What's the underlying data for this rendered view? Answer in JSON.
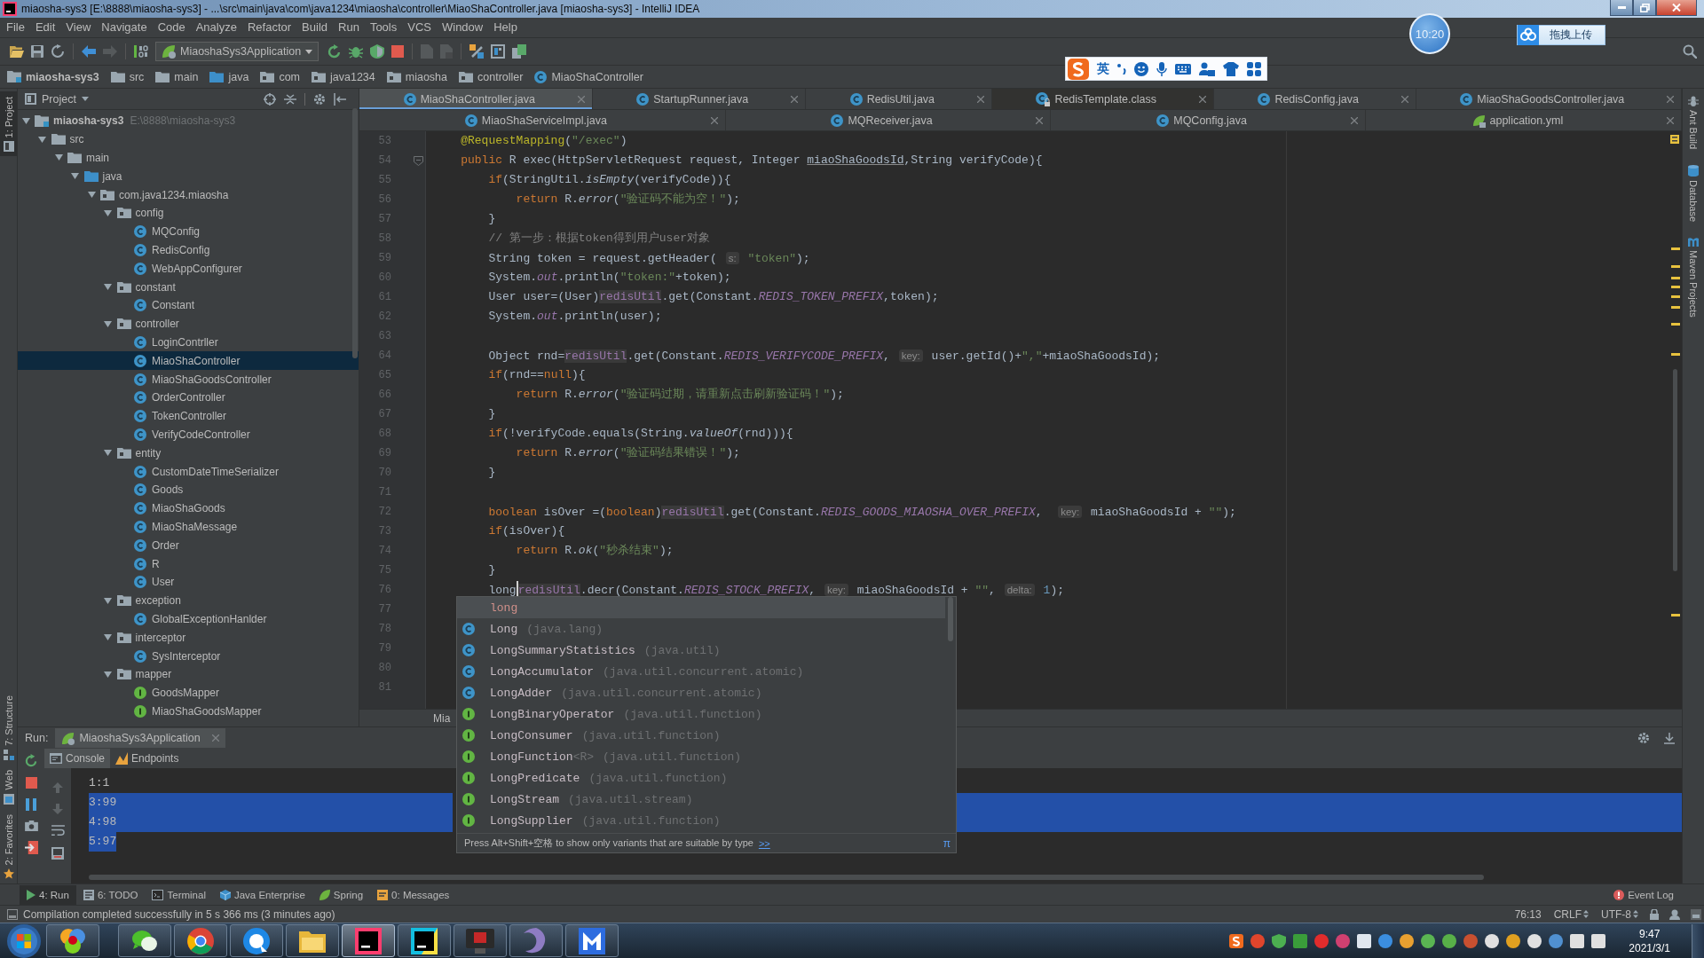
{
  "window": {
    "title": "miaosha-sys3 [E:\\8888\\miaosha-sys3] - ...\\src\\main\\java\\com\\java1234\\miaosha\\controller\\MiaoShaController.java [miaosha-sys3] - IntelliJ IDEA"
  },
  "menu": [
    "File",
    "Edit",
    "View",
    "Navigate",
    "Code",
    "Analyze",
    "Refactor",
    "Build",
    "Run",
    "Tools",
    "VCS",
    "Window",
    "Help"
  ],
  "toolbar": {
    "run_configuration": "MiaoshaSys3Application"
  },
  "overlays": {
    "recorder_time": "10:20",
    "upload_button": "拖拽上传",
    "ime_mode": "英"
  },
  "navigation_bar": [
    {
      "label": "miaosha-sys3",
      "kind": "module"
    },
    {
      "label": "src",
      "kind": "folder"
    },
    {
      "label": "main",
      "kind": "folder"
    },
    {
      "label": "java",
      "kind": "source-folder"
    },
    {
      "label": "com",
      "kind": "package"
    },
    {
      "label": "java1234",
      "kind": "package"
    },
    {
      "label": "miaosha",
      "kind": "package"
    },
    {
      "label": "controller",
      "kind": "package"
    },
    {
      "label": "MiaoShaController",
      "kind": "class"
    }
  ],
  "tool_stripe_left": [
    {
      "label": "1: Project",
      "selected": true
    },
    {
      "label": "7: Structure",
      "selected": false
    },
    {
      "label": "Web",
      "selected": false
    },
    {
      "label": "2: Favorites",
      "selected": false
    }
  ],
  "tool_stripe_right": [
    {
      "label": "Ant Build"
    },
    {
      "label": "Database"
    },
    {
      "label": "Maven Projects"
    }
  ],
  "project_panel": {
    "title": "Project",
    "tree": [
      {
        "label": "miaosha-sys3",
        "path": "E:\\8888\\miaosha-sys3",
        "kind": "module",
        "expanded": true,
        "selected": false,
        "children": [
          {
            "label": "src",
            "kind": "folder",
            "expanded": true,
            "selected": false,
            "children": [
              {
                "label": "main",
                "kind": "folder",
                "expanded": true,
                "selected": false,
                "children": [
                  {
                    "label": "java",
                    "kind": "source-folder",
                    "expanded": true,
                    "selected": false,
                    "children": [
                      {
                        "label": "com.java1234.miaosha",
                        "kind": "package",
                        "expanded": true,
                        "selected": false,
                        "children": [
                          {
                            "label": "config",
                            "kind": "package",
                            "expanded": true,
                            "selected": false,
                            "children": [
                              {
                                "label": "MQConfig",
                                "kind": "class",
                                "selected": false
                              },
                              {
                                "label": "RedisConfig",
                                "kind": "class",
                                "selected": false
                              },
                              {
                                "label": "WebAppConfigurer",
                                "kind": "class",
                                "selected": false
                              }
                            ]
                          },
                          {
                            "label": "constant",
                            "kind": "package",
                            "expanded": true,
                            "selected": false,
                            "children": [
                              {
                                "label": "Constant",
                                "kind": "class",
                                "selected": false
                              }
                            ]
                          },
                          {
                            "label": "controller",
                            "kind": "package",
                            "expanded": true,
                            "selected": false,
                            "children": [
                              {
                                "label": "LoginContrller",
                                "kind": "class",
                                "selected": false
                              },
                              {
                                "label": "MiaoShaController",
                                "kind": "class",
                                "selected": true
                              },
                              {
                                "label": "MiaoShaGoodsController",
                                "kind": "class",
                                "selected": false
                              },
                              {
                                "label": "OrderController",
                                "kind": "class",
                                "selected": false
                              },
                              {
                                "label": "TokenController",
                                "kind": "class",
                                "selected": false
                              },
                              {
                                "label": "VerifyCodeController",
                                "kind": "class",
                                "selected": false
                              }
                            ]
                          },
                          {
                            "label": "entity",
                            "kind": "package",
                            "expanded": true,
                            "selected": false,
                            "children": [
                              {
                                "label": "CustomDateTimeSerializer",
                                "kind": "class",
                                "selected": false
                              },
                              {
                                "label": "Goods",
                                "kind": "class",
                                "selected": false
                              },
                              {
                                "label": "MiaoShaGoods",
                                "kind": "class",
                                "selected": false
                              },
                              {
                                "label": "MiaoShaMessage",
                                "kind": "class",
                                "selected": false
                              },
                              {
                                "label": "Order",
                                "kind": "class",
                                "selected": false
                              },
                              {
                                "label": "R",
                                "kind": "class",
                                "selected": false
                              },
                              {
                                "label": "User",
                                "kind": "class",
                                "selected": false
                              }
                            ]
                          },
                          {
                            "label": "exception",
                            "kind": "package",
                            "expanded": true,
                            "selected": false,
                            "children": [
                              {
                                "label": "GlobalExceptionHanlder",
                                "kind": "class",
                                "selected": false
                              }
                            ]
                          },
                          {
                            "label": "interceptor",
                            "kind": "package",
                            "expanded": true,
                            "selected": false,
                            "children": [
                              {
                                "label": "SysInterceptor",
                                "kind": "class",
                                "selected": false
                              }
                            ]
                          },
                          {
                            "label": "mapper",
                            "kind": "package",
                            "expanded": true,
                            "selected": false,
                            "children": [
                              {
                                "label": "GoodsMapper",
                                "kind": "interface",
                                "selected": false
                              },
                              {
                                "label": "MiaoShaGoodsMapper",
                                "kind": "interface",
                                "selected": false
                              }
                            ]
                          }
                        ]
                      }
                    ]
                  }
                ]
              }
            ]
          }
        ]
      }
    ]
  },
  "editor_tabs": {
    "rows": [
      {
        "tabs": [
          {
            "label": "MiaoShaController.java",
            "kind": "class",
            "selected": true
          },
          {
            "label": "StartupRunner.java",
            "kind": "class",
            "selected": false
          },
          {
            "label": "RedisUtil.java",
            "kind": "class",
            "selected": false
          },
          {
            "label": "RedisTemplate.class",
            "kind": "library-class",
            "selected": false
          },
          {
            "label": "RedisConfig.java",
            "kind": "class",
            "selected": false
          },
          {
            "label": "MiaoShaGoodsController.java",
            "kind": "class",
            "selected": false
          }
        ]
      },
      {
        "tabs": [
          {
            "label": "MiaoShaServiceImpl.java",
            "kind": "class",
            "selected": false
          },
          {
            "label": "MQReceiver.java",
            "kind": "class",
            "selected": false
          },
          {
            "label": "MQConfig.java",
            "kind": "class",
            "selected": false
          },
          {
            "label": "application.yml",
            "kind": "config",
            "selected": false
          }
        ]
      }
    ]
  },
  "editor": {
    "lines": [
      {
        "number": "53",
        "tokens": [
          {
            "kind": "annotation",
            "text": "    @RequestMapping"
          },
          {
            "kind": "plain",
            "text": "("
          },
          {
            "kind": "string",
            "text": "\"/exec\""
          },
          {
            "kind": "plain",
            "text": ")"
          }
        ]
      },
      {
        "number": "54",
        "fold_marker": true,
        "tokens": [
          {
            "kind": "keyword",
            "text": "    public"
          },
          {
            "kind": "plain",
            "text": " R exec(HttpServletRequest request, Integer "
          },
          {
            "kind": "underlined",
            "text": "miaoShaGoodsId"
          },
          {
            "kind": "plain",
            "text": ",String verifyCode){"
          }
        ]
      },
      {
        "number": "55",
        "tokens": [
          {
            "kind": "keyword",
            "text": "        if"
          },
          {
            "kind": "plain",
            "text": "(StringUtil."
          },
          {
            "kind": "static-method",
            "text": "isEmpty"
          },
          {
            "kind": "plain",
            "text": "(verifyCode)){"
          }
        ]
      },
      {
        "number": "56",
        "tokens": [
          {
            "kind": "keyword",
            "text": "            return"
          },
          {
            "kind": "plain",
            "text": " R."
          },
          {
            "kind": "static-method",
            "text": "error"
          },
          {
            "kind": "plain",
            "text": "("
          },
          {
            "kind": "string",
            "text": "\"验证码不能为空！\""
          },
          {
            "kind": "plain",
            "text": ");"
          }
        ]
      },
      {
        "number": "57",
        "tokens": [
          {
            "kind": "plain",
            "text": "        }"
          }
        ]
      },
      {
        "number": "58",
        "tokens": [
          {
            "kind": "comment",
            "text": "        // 第一步：根据token得到用户user对象"
          }
        ]
      },
      {
        "number": "59",
        "tokens": [
          {
            "kind": "plain",
            "text": "        String token = request.getHeader( "
          },
          {
            "kind": "hint",
            "text": "s:"
          },
          {
            "kind": "string",
            "text": " \"token\""
          },
          {
            "kind": "plain",
            "text": ");"
          }
        ]
      },
      {
        "number": "60",
        "tokens": [
          {
            "kind": "plain",
            "text": "        System."
          },
          {
            "kind": "static-field",
            "text": "out"
          },
          {
            "kind": "plain",
            "text": ".println("
          },
          {
            "kind": "string",
            "text": "\"token:\""
          },
          {
            "kind": "plain",
            "text": "+token);"
          }
        ]
      },
      {
        "number": "61",
        "tokens": [
          {
            "kind": "plain",
            "text": "        User user=(User)"
          },
          {
            "kind": "field",
            "text": "redisUtil"
          },
          {
            "kind": "plain",
            "text": ".get(Constant."
          },
          {
            "kind": "constant",
            "text": "REDIS_TOKEN_PREFIX"
          },
          {
            "kind": "plain",
            "text": ",token);"
          }
        ]
      },
      {
        "number": "62",
        "tokens": [
          {
            "kind": "plain",
            "text": "        System."
          },
          {
            "kind": "static-field",
            "text": "out"
          },
          {
            "kind": "plain",
            "text": ".println(user);"
          }
        ]
      },
      {
        "number": "63"
      },
      {
        "number": "64",
        "tokens": [
          {
            "kind": "plain",
            "text": "        Object rnd="
          },
          {
            "kind": "field",
            "text": "redisUtil"
          },
          {
            "kind": "plain",
            "text": ".get(Constant."
          },
          {
            "kind": "constant",
            "text": "REDIS_VERIFYCODE_PREFIX"
          },
          {
            "kind": "plain",
            "text": ", "
          },
          {
            "kind": "hint",
            "text": "key:"
          },
          {
            "kind": "plain",
            "text": " user.getId()+"
          },
          {
            "kind": "string",
            "text": "\",\""
          },
          {
            "kind": "plain",
            "text": "+miaoShaGoodsId);"
          }
        ]
      },
      {
        "number": "65",
        "tokens": [
          {
            "kind": "keyword",
            "text": "        if"
          },
          {
            "kind": "plain",
            "text": "(rnd=="
          },
          {
            "kind": "keyword",
            "text": "null"
          },
          {
            "kind": "plain",
            "text": "){"
          }
        ]
      },
      {
        "number": "66",
        "tokens": [
          {
            "kind": "keyword",
            "text": "            return"
          },
          {
            "kind": "plain",
            "text": " R."
          },
          {
            "kind": "static-method",
            "text": "error"
          },
          {
            "kind": "plain",
            "text": "("
          },
          {
            "kind": "string",
            "text": "\"验证码过期，请重新点击刷新验证码！\""
          },
          {
            "kind": "plain",
            "text": ");"
          }
        ]
      },
      {
        "number": "67",
        "tokens": [
          {
            "kind": "plain",
            "text": "        }"
          }
        ]
      },
      {
        "number": "68",
        "tokens": [
          {
            "kind": "keyword",
            "text": "        if"
          },
          {
            "kind": "plain",
            "text": "(!verifyCode.equals(String."
          },
          {
            "kind": "static-method",
            "text": "valueOf"
          },
          {
            "kind": "plain",
            "text": "(rnd))){"
          }
        ]
      },
      {
        "number": "69",
        "tokens": [
          {
            "kind": "keyword",
            "text": "            return"
          },
          {
            "kind": "plain",
            "text": " R."
          },
          {
            "kind": "static-method",
            "text": "error"
          },
          {
            "kind": "plain",
            "text": "("
          },
          {
            "kind": "string",
            "text": "\"验证码结果错误！\""
          },
          {
            "kind": "plain",
            "text": ");"
          }
        ]
      },
      {
        "number": "70",
        "tokens": [
          {
            "kind": "plain",
            "text": "        }"
          }
        ]
      },
      {
        "number": "71"
      },
      {
        "number": "72",
        "tokens": [
          {
            "kind": "keyword",
            "text": "        boolean"
          },
          {
            "kind": "plain",
            "text": " isOver =("
          },
          {
            "kind": "keyword",
            "text": "boolean"
          },
          {
            "kind": "plain",
            "text": ")"
          },
          {
            "kind": "field",
            "text": "redisUtil"
          },
          {
            "kind": "plain",
            "text": ".get(Constant."
          },
          {
            "kind": "constant",
            "text": "REDIS_GOODS_MIAOSHA_OVER_PREFIX"
          },
          {
            "kind": "plain",
            "text": ",  "
          },
          {
            "kind": "hint",
            "text": "key:"
          },
          {
            "kind": "plain",
            "text": " miaoShaGoodsId + "
          },
          {
            "kind": "string",
            "text": "\"\""
          },
          {
            "kind": "plain",
            "text": ");"
          }
        ]
      },
      {
        "number": "73",
        "tokens": [
          {
            "kind": "keyword",
            "text": "        if"
          },
          {
            "kind": "plain",
            "text": "(isOver){"
          }
        ]
      },
      {
        "number": "74",
        "tokens": [
          {
            "kind": "keyword",
            "text": "            return"
          },
          {
            "kind": "plain",
            "text": " R."
          },
          {
            "kind": "static-method",
            "text": "ok"
          },
          {
            "kind": "plain",
            "text": "("
          },
          {
            "kind": "string",
            "text": "\"秒杀结束\""
          },
          {
            "kind": "plain",
            "text": ");"
          }
        ]
      },
      {
        "number": "75",
        "tokens": [
          {
            "kind": "plain",
            "text": "        }"
          }
        ]
      },
      {
        "number": "76",
        "tokens": [
          {
            "kind": "plain",
            "text": "        long"
          },
          {
            "kind": "caret"
          },
          {
            "kind": "field",
            "text": "redisUtil"
          },
          {
            "kind": "plain",
            "text": ".decr(Constant."
          },
          {
            "kind": "constant",
            "text": "REDIS_STOCK_PREFIX"
          },
          {
            "kind": "plain",
            "text": ", "
          },
          {
            "kind": "hint",
            "text": "key:"
          },
          {
            "kind": "plain",
            "text": " miaoShaGoodsId + "
          },
          {
            "kind": "string",
            "text": "\"\""
          },
          {
            "kind": "plain",
            "text": ", "
          },
          {
            "kind": "hint",
            "text": "delta:"
          },
          {
            "kind": "number",
            "text": " 1"
          },
          {
            "kind": "plain",
            "text": ");"
          }
        ]
      },
      {
        "number": "77"
      },
      {
        "number": "78"
      },
      {
        "number": "79"
      },
      {
        "number": "80"
      },
      {
        "number": "81"
      }
    ],
    "breadcrumb": "Mia"
  },
  "completion_popup": {
    "items": [
      {
        "name": "long",
        "kind": "keyword",
        "selected": true
      },
      {
        "name": "Long",
        "package": "(java.lang)",
        "kind": "class",
        "selected": false
      },
      {
        "name": "LongSummaryStatistics",
        "package": "(java.util)",
        "kind": "class",
        "selected": false
      },
      {
        "name": "LongAccumulator",
        "package": "(java.util.concurrent.atomic)",
        "kind": "class",
        "selected": false
      },
      {
        "name": "LongAdder",
        "package": "(java.util.concurrent.atomic)",
        "kind": "class",
        "selected": false
      },
      {
        "name": "LongBinaryOperator",
        "package": "(java.util.function)",
        "kind": "interface",
        "selected": false
      },
      {
        "name": "LongConsumer",
        "package": "(java.util.function)",
        "kind": "interface",
        "selected": false
      },
      {
        "name": "LongFunction",
        "type_parameters": "<R>",
        "package": "(java.util.function)",
        "kind": "interface",
        "selected": false
      },
      {
        "name": "LongPredicate",
        "package": "(java.util.function)",
        "kind": "interface",
        "selected": false
      },
      {
        "name": "LongStream",
        "package": "(java.util.stream)",
        "kind": "interface",
        "selected": false
      },
      {
        "name": "LongSupplier",
        "package": "(java.util.function)",
        "kind": "interface",
        "selected": false
      }
    ],
    "hint": "Press Alt+Shift+空格 to show only variants that are suitable by type",
    "hint_link": ">>",
    "pin": "π"
  },
  "run_panel": {
    "label": "Run:",
    "config_tab": "MiaoshaSys3Application",
    "tabs": [
      {
        "label": "Console",
        "selected": true
      },
      {
        "label": "Endpoints",
        "selected": false
      }
    ],
    "console_lines": [
      {
        "text": "1:1",
        "selected": false
      },
      {
        "text": "3:99",
        "selected": true
      },
      {
        "text": "4:98",
        "selected": true
      },
      {
        "text": "5:97",
        "selected": true
      }
    ]
  },
  "bottom_tool_buttons": [
    {
      "label": "4: Run",
      "selected": true
    },
    {
      "label": "6: TODO",
      "selected": false
    },
    {
      "label": "Terminal",
      "selected": false
    },
    {
      "label": "Java Enterprise",
      "selected": false
    },
    {
      "label": "Spring",
      "selected": false
    },
    {
      "label": "0: Messages",
      "selected": false
    }
  ],
  "event_log": "Event Log",
  "status_bar": {
    "message": "Compilation completed successfully in 5 s 366 ms (3 minutes ago)",
    "caret_position": "76:13",
    "line_separator": "CRLF",
    "encoding": "UTF-8"
  },
  "taskbar": {
    "apps": [
      {
        "active": false
      },
      {
        "active": false
      },
      {
        "active": false
      },
      {
        "active": false
      },
      {
        "active": false
      },
      {
        "active": true
      },
      {
        "active": false
      },
      {
        "active": false
      },
      {
        "active": false
      },
      {
        "active": false
      }
    ],
    "clock": {
      "time": "9:47",
      "date": "2021/3/1"
    }
  }
}
